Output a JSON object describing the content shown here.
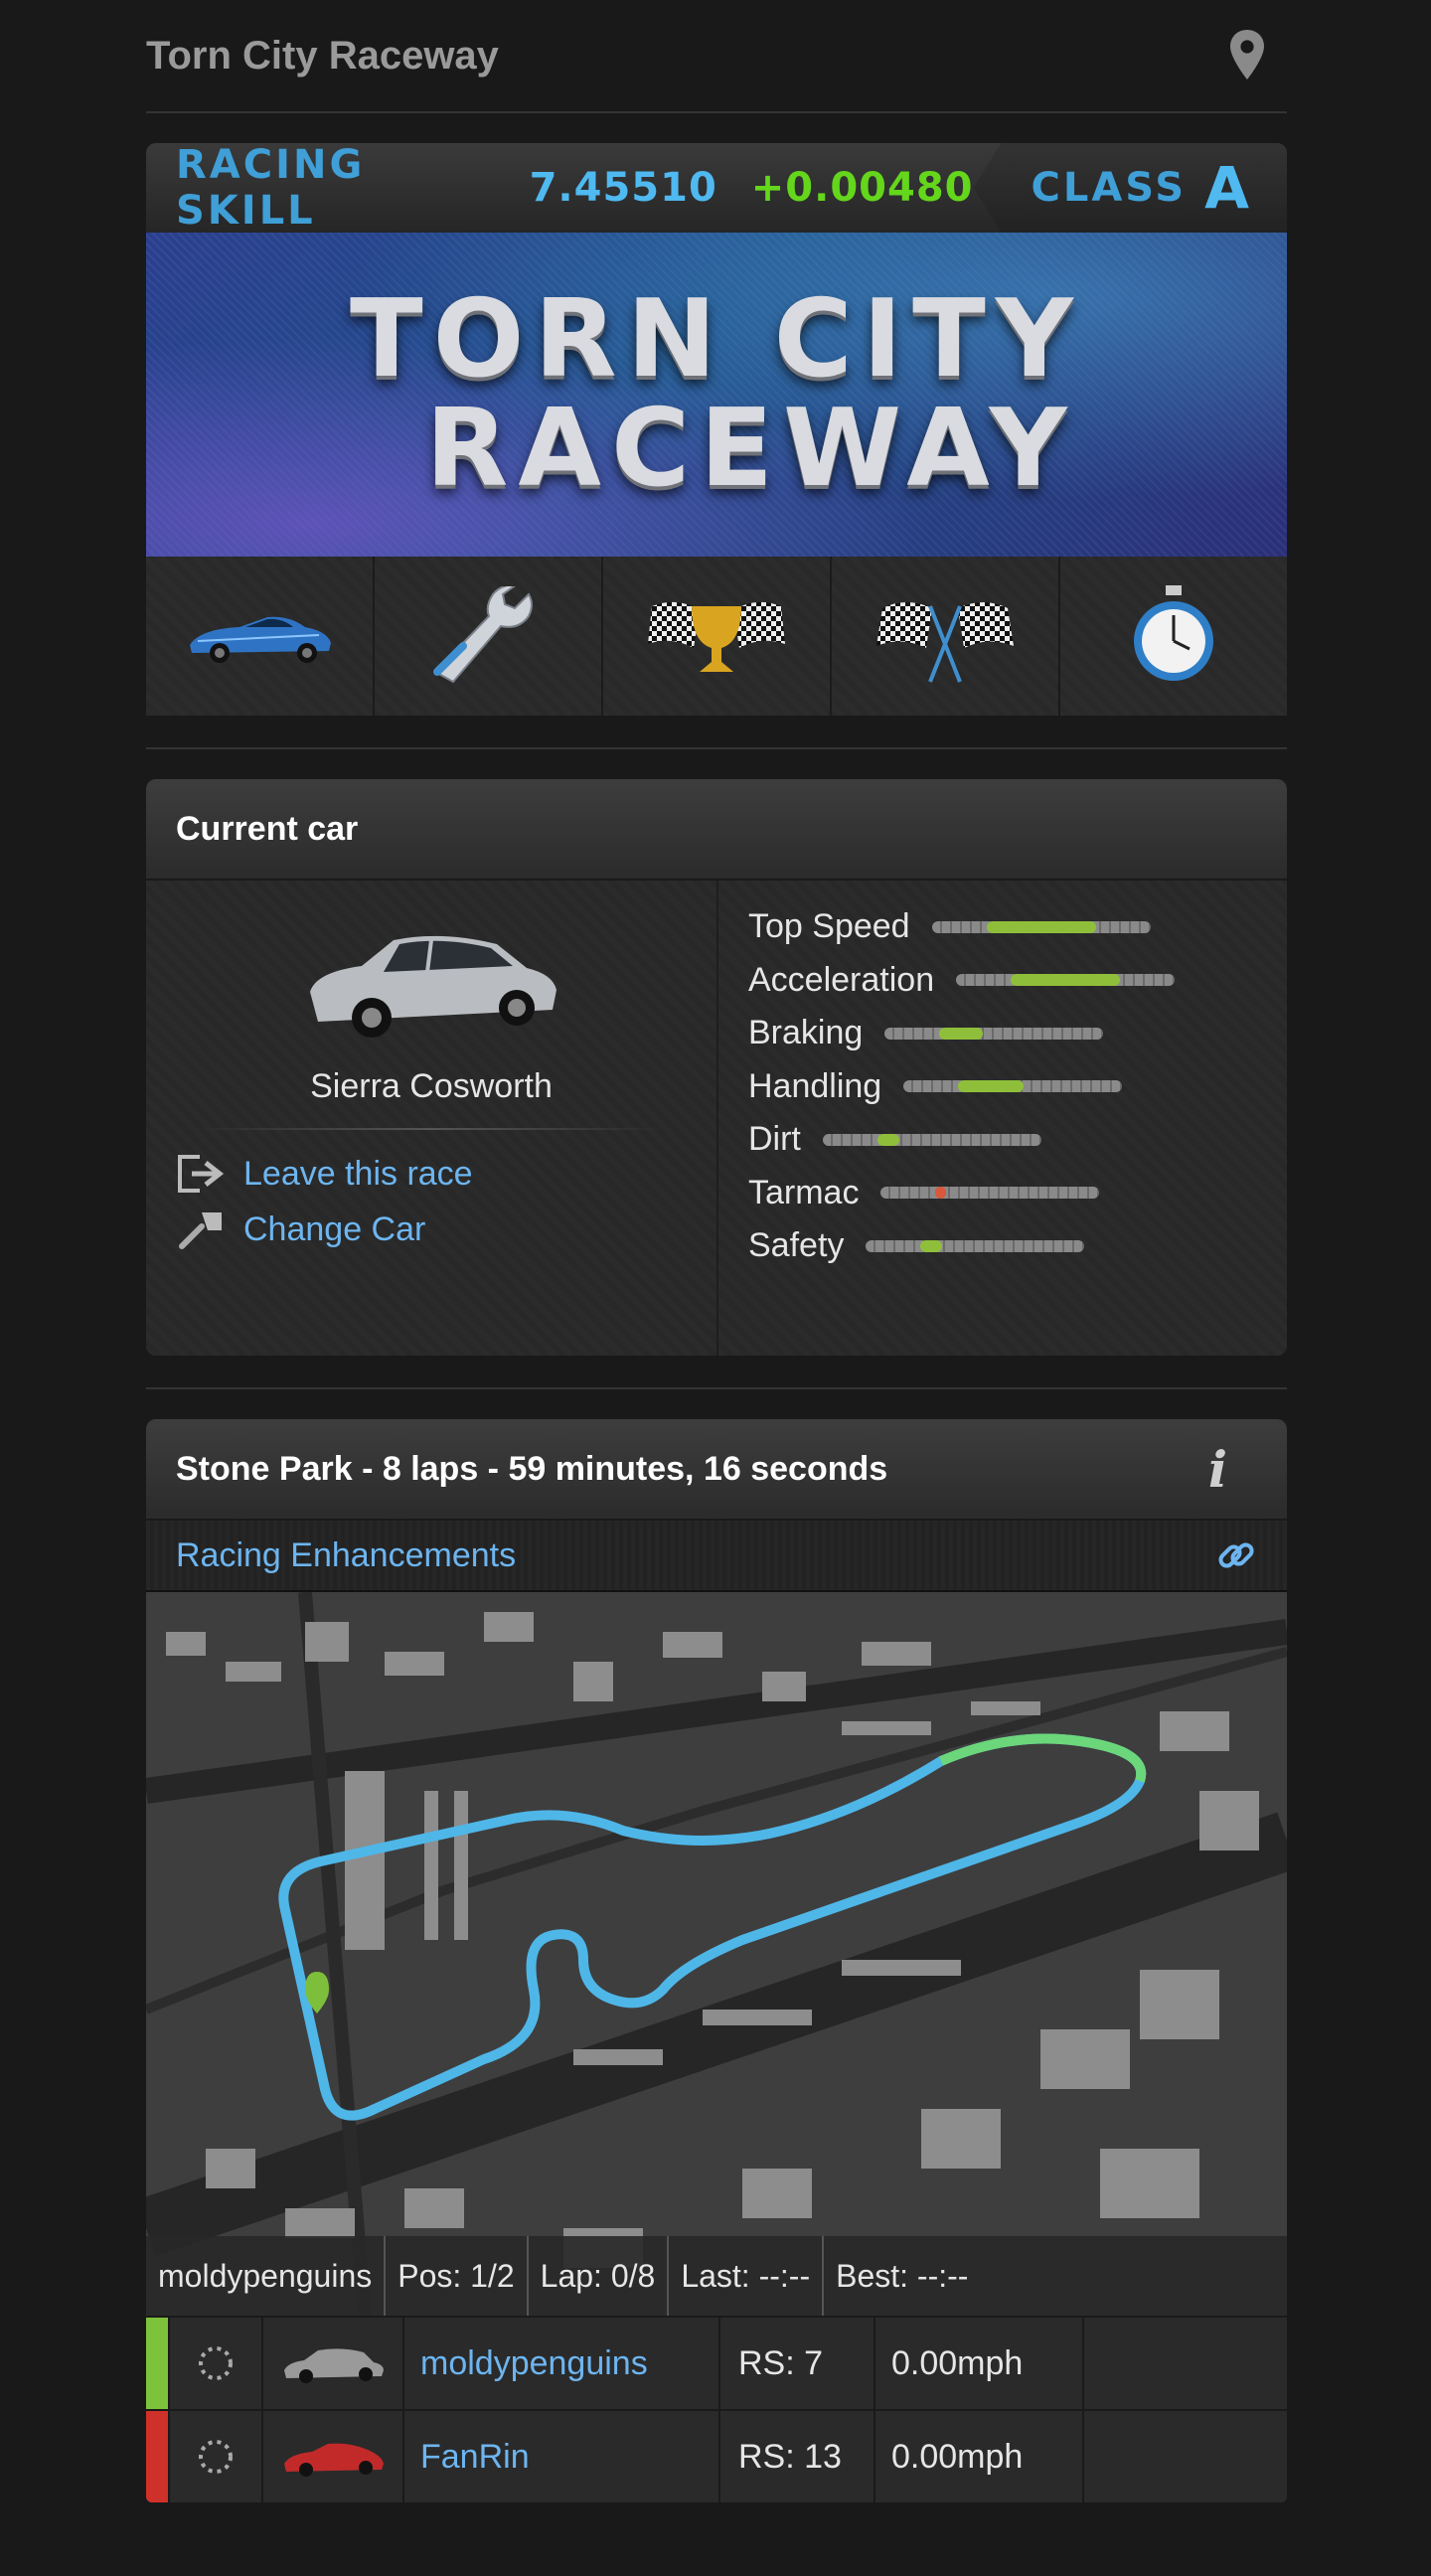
{
  "header": {
    "title": "Torn City Raceway"
  },
  "skill": {
    "label": "RACING SKILL",
    "value": "7.45510",
    "delta": "+0.00480",
    "class_label": "CLASS",
    "class_value": "A"
  },
  "banner": {
    "line1": "TORN CITY",
    "line2": "RACEWAY"
  },
  "nav_icons": [
    "race-car-icon",
    "wrench-icon",
    "trophy-flags-icon",
    "checkered-flags-icon",
    "stopwatch-icon"
  ],
  "current_car": {
    "title": "Current car",
    "car_name": "Sierra Cosworth",
    "links": {
      "leave": "Leave this race",
      "change": "Change Car"
    },
    "stats": [
      {
        "name": "Top Speed",
        "level": 0.5,
        "color": "#8fbf3a"
      },
      {
        "name": "Acceleration",
        "level": 0.5,
        "color": "#8fbf3a"
      },
      {
        "name": "Braking",
        "level": 0.2,
        "color": "#8fbf3a"
      },
      {
        "name": "Handling",
        "level": 0.3,
        "color": "#8fbf3a"
      },
      {
        "name": "Dirt",
        "level": 0.1,
        "color": "#8fbf3a"
      },
      {
        "name": "Tarmac",
        "level": 0.05,
        "color": "#d9573a"
      },
      {
        "name": "Safety",
        "level": 0.1,
        "color": "#8fbf3a"
      }
    ]
  },
  "race": {
    "title": "Stone Park - 8 laps - 59 minutes, 16 seconds",
    "enhancements": "Racing Enhancements",
    "status": {
      "player": "moldypenguins",
      "pos": "Pos: 1/2",
      "lap": "Lap: 0/8",
      "last": "Last: --:--",
      "best": "Best: --:--"
    },
    "racers": [
      {
        "name": "moldypenguins",
        "rs": "RS: 7",
        "speed": "0.00mph",
        "color": "#7dc23b",
        "car_color": "#9a9a9a"
      },
      {
        "name": "FanRin",
        "rs": "RS: 13",
        "speed": "0.00mph",
        "color": "#d0302a",
        "car_color": "#c22a2a"
      }
    ]
  }
}
